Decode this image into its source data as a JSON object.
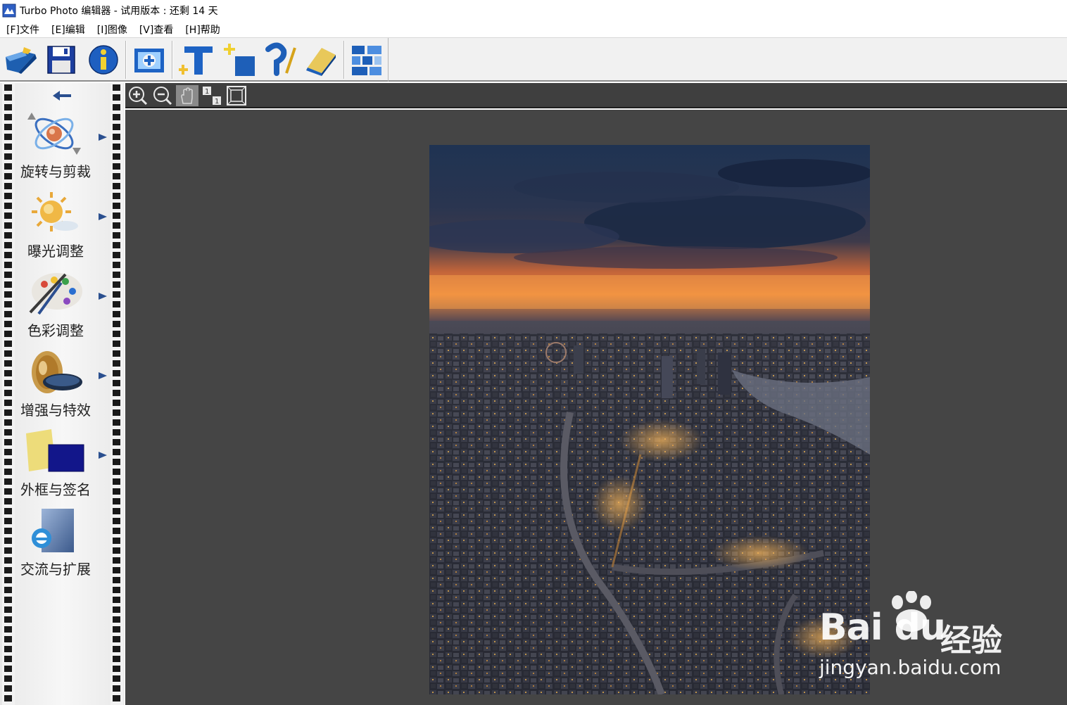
{
  "window": {
    "title": "Turbo Photo 编辑器  - 试用版本 : 还剩 14 天"
  },
  "menu": [
    {
      "label": "[F]文件"
    },
    {
      "label": "[E]编辑"
    },
    {
      "label": "[I]图像"
    },
    {
      "label": "[V]查看"
    },
    {
      "label": "[H]帮助"
    }
  ],
  "toolbar": {
    "buttons": [
      {
        "icon": "open-folder-icon"
      },
      {
        "icon": "save-disk-icon"
      },
      {
        "icon": "info-icon"
      },
      {
        "icon": "add-image-icon"
      },
      {
        "icon": "add-text-icon"
      },
      {
        "icon": "add-layer-icon"
      },
      {
        "icon": "undo-brush-icon"
      },
      {
        "icon": "eraser-icon"
      },
      {
        "icon": "batch-grid-icon"
      }
    ]
  },
  "sidebar": {
    "back_icon": "back-arrow-icon",
    "tools": [
      {
        "label": "旋转与剪裁",
        "icon": "rotate-crop-icon",
        "has_submenu": true
      },
      {
        "label": "曝光调整",
        "icon": "exposure-sun-icon",
        "has_submenu": true
      },
      {
        "label": "色彩调整",
        "icon": "color-palette-icon",
        "has_submenu": true
      },
      {
        "label": "增强与特效",
        "icon": "enhance-lens-icon",
        "has_submenu": true
      },
      {
        "label": "外框与签名",
        "icon": "frame-signature-icon",
        "has_submenu": true
      },
      {
        "label": "交流与扩展",
        "icon": "share-ie-icon",
        "has_submenu": false
      }
    ]
  },
  "zoom_toolbar": {
    "buttons": [
      {
        "icon": "zoom-in-icon"
      },
      {
        "icon": "zoom-out-icon"
      },
      {
        "icon": "pan-hand-icon",
        "active": true
      },
      {
        "icon": "actual-size-icon"
      },
      {
        "icon": "fit-window-icon"
      }
    ]
  },
  "canvas": {
    "background": "#454545",
    "image_subject": "aerial-city-dusk-photo"
  },
  "watermark": {
    "brand": "Bai du",
    "cn": "经验",
    "url": "jingyan.baidu.com"
  },
  "colors": {
    "toolbar_bg": "#f1f1f1",
    "canvas_bg": "#454545",
    "zoombar_bg": "#3f3f3f",
    "accent_blue": "#1e5fb0",
    "sky_orange": "#f08a3a"
  }
}
